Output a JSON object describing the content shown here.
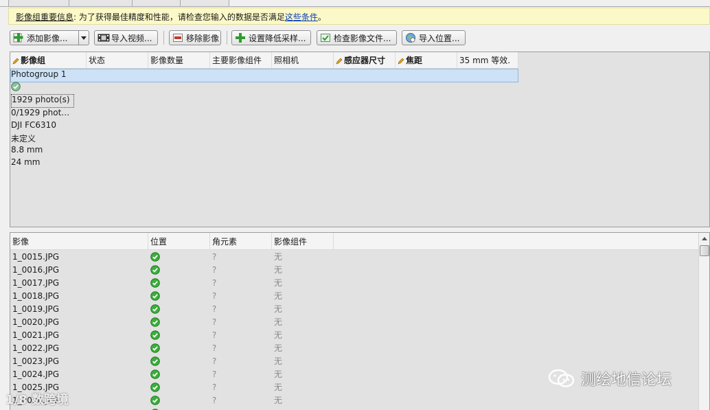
{
  "notice": {
    "label": "影像组重要信息",
    "text": ": 为了获得最佳精度和性能，请检查您输入的数据是否满足",
    "link": "这些条件",
    "tail": "。"
  },
  "toolbar": {
    "add_photos": "添加影像...",
    "import_video": "导入视频...",
    "remove_photos": "移除影像",
    "set_downsampling": "设置降低采样...",
    "check_image_files": "检查影像文件...",
    "import_positions": "导入位置..."
  },
  "photogroups": {
    "headers": [
      "影像组",
      "状态",
      "影像数量",
      "主要影像组件",
      "照相机",
      "感应器尺寸",
      "焦距",
      "35 mm 等效."
    ],
    "rows": [
      {
        "name": "Photogroup 1",
        "status": "ok",
        "count": "1929 photo(s)",
        "main_component": "0/1929 phot…",
        "camera": "DJI FC6310",
        "sensor_size": "未定义",
        "focal_length": "8.8 mm",
        "equiv_35mm": "24 mm"
      }
    ]
  },
  "photos": {
    "headers": [
      "影像",
      "位置",
      "角元素",
      "影像组件"
    ],
    "rows": [
      {
        "name": "1_0015.JPG",
        "position": "ok",
        "rotation": "?",
        "component": "无"
      },
      {
        "name": "1_0016.JPG",
        "position": "ok",
        "rotation": "?",
        "component": "无"
      },
      {
        "name": "1_0017.JPG",
        "position": "ok",
        "rotation": "?",
        "component": "无"
      },
      {
        "name": "1_0018.JPG",
        "position": "ok",
        "rotation": "?",
        "component": "无"
      },
      {
        "name": "1_0019.JPG",
        "position": "ok",
        "rotation": "?",
        "component": "无"
      },
      {
        "name": "1_0020.JPG",
        "position": "ok",
        "rotation": "?",
        "component": "无"
      },
      {
        "name": "1_0021.JPG",
        "position": "ok",
        "rotation": "?",
        "component": "无"
      },
      {
        "name": "1_0022.JPG",
        "position": "ok",
        "rotation": "?",
        "component": "无"
      },
      {
        "name": "1_0023.JPG",
        "position": "ok",
        "rotation": "?",
        "component": "无"
      },
      {
        "name": "1_0024.JPG",
        "position": "ok",
        "rotation": "?",
        "component": "无"
      },
      {
        "name": "1_0025.JPG",
        "position": "ok",
        "rotation": "?",
        "component": "无"
      },
      {
        "name": "1_0026.JPG",
        "position": "ok",
        "rotation": "?",
        "component": "无"
      },
      {
        "name": "",
        "position": "ok",
        "rotation": "",
        "component": ""
      }
    ]
  },
  "watermark": {
    "forum": "测绘地信论坛",
    "corner": "1/8 数跨境"
  },
  "colors": {
    "check_green": "#3cae3c",
    "selection": "#cde2f7",
    "notice_bg": "#fcf9c8",
    "link": "#0b3fb5"
  },
  "icons": {
    "add": "plus-icon",
    "video": "film-icon",
    "remove": "remove-icon",
    "downsample": "downsample-icon",
    "check": "check-files-icon",
    "import": "globe-icon",
    "edit": "pencil-icon",
    "ok": "check-circle-icon"
  }
}
